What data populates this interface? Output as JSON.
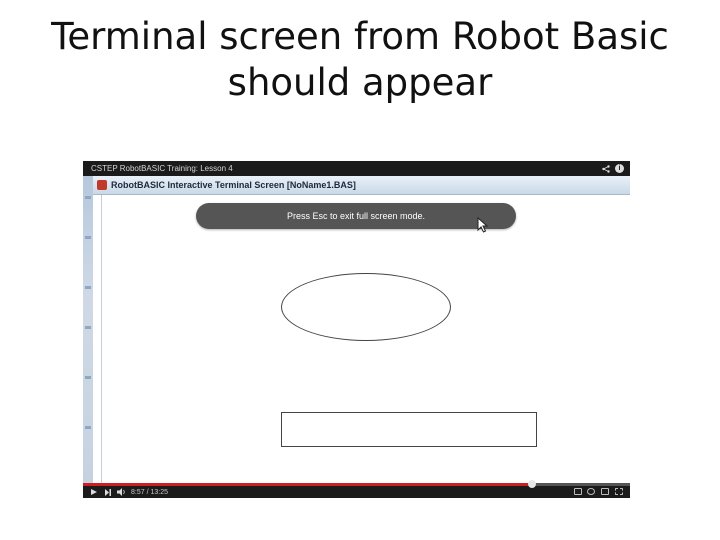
{
  "slide": {
    "title_line1": "Terminal screen from Robot Basic",
    "title_line2": "should appear"
  },
  "video": {
    "title": "CSTEP RobotBASIC Training: Lesson 4",
    "share_icon": "share-icon",
    "info_label": "i",
    "time": "8:57 / 13:25",
    "progress": 0.82,
    "progress_color": "#cc1f1f"
  },
  "app_window": {
    "title": "RobotBASIC Interactive Terminal Screen  [NoName1.BAS]",
    "icon": "robotbasic-app-icon"
  },
  "overlay": {
    "fullscreen_notice": "Press Esc to exit full screen mode."
  },
  "canvas": {
    "shapes": [
      "ellipse",
      "rectangle"
    ]
  }
}
